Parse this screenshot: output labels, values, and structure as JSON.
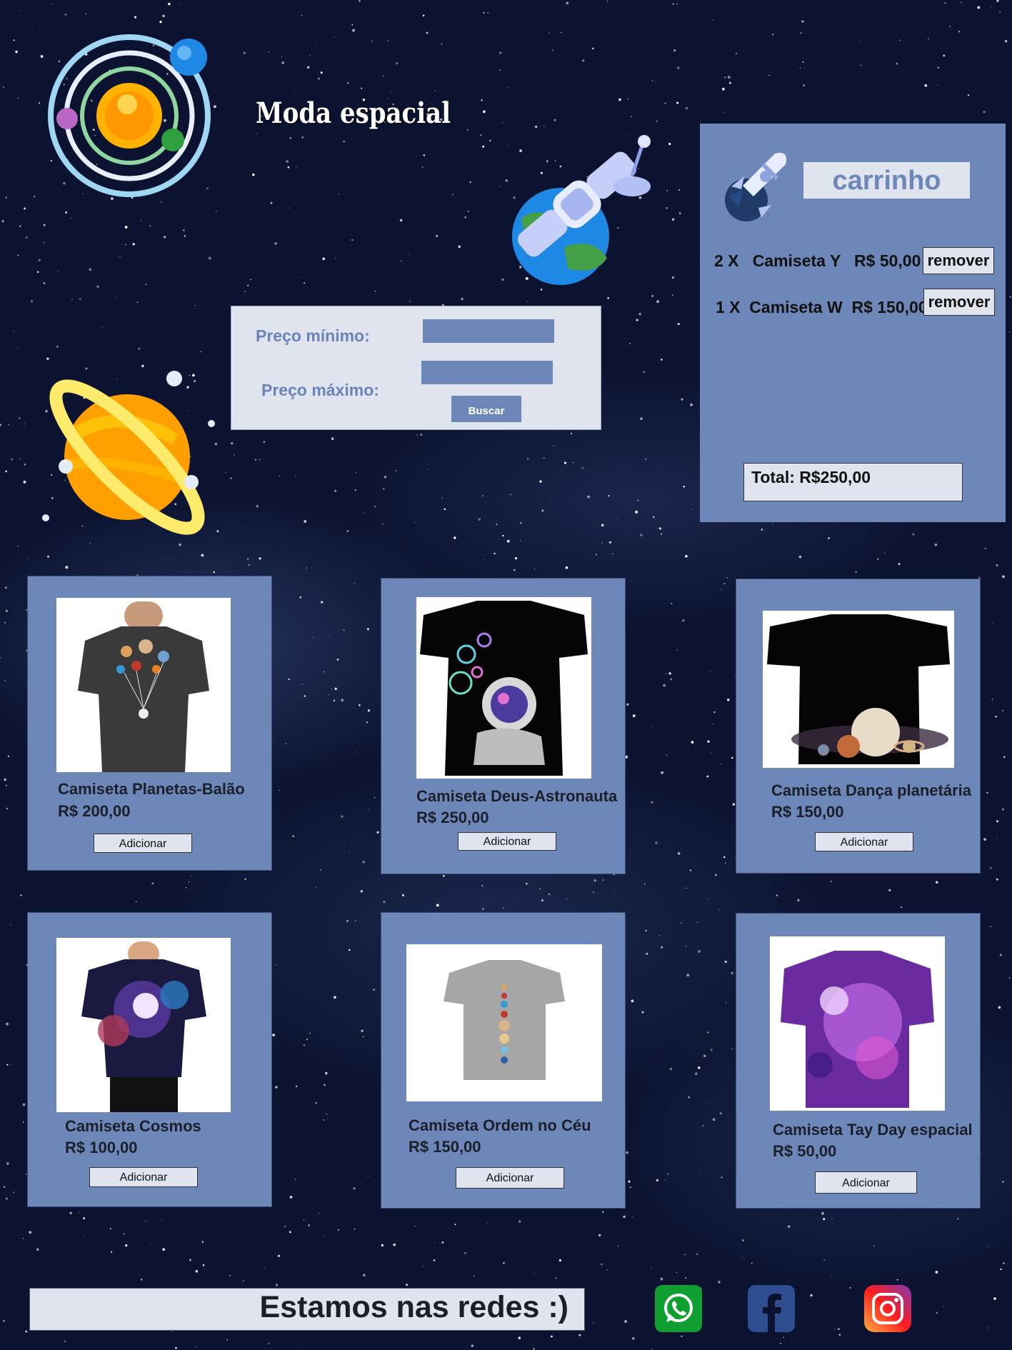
{
  "header": {
    "title": "Moda espacial"
  },
  "filter": {
    "min_label": "Preço mínimo:",
    "max_label": "Preço máximo:",
    "search_label": "Buscar"
  },
  "cart": {
    "title": "carrinho",
    "items": [
      {
        "line": "2 X   Camiseta Y   R$ 50,00",
        "remove_label": "remover"
      },
      {
        "line": "1 X  Camiseta W  R$ 150,00",
        "remove_label": "remover"
      }
    ],
    "total": "Total:  R$250,00"
  },
  "products": [
    {
      "name": "Camiseta Planetas-Balão",
      "price": "R$ 200,00",
      "add_label": "Adicionar"
    },
    {
      "name": "Camiseta Deus-Astronauta",
      "price": "R$ 250,00",
      "add_label": "Adicionar"
    },
    {
      "name": "Camiseta Dança planetária",
      "price": "R$ 150,00",
      "add_label": "Adicionar"
    },
    {
      "name": "Camiseta Cosmos",
      "price": "R$ 100,00",
      "add_label": "Adicionar"
    },
    {
      "name": "Camiseta Ordem no Céu",
      "price": "R$ 150,00",
      "add_label": "Adicionar"
    },
    {
      "name": "Camiseta Tay Day espacial",
      "price": "R$ 50,00",
      "add_label": "Adicionar"
    }
  ],
  "footer": {
    "text": "Estamos nas redes :)"
  },
  "social": [
    {
      "icon": "whatsapp-icon",
      "color": "#0e9f30"
    },
    {
      "icon": "facebook-icon",
      "color": "#2f4e8f"
    },
    {
      "icon": "instagram-icon",
      "color": "#e1306c"
    }
  ],
  "colors": {
    "panel": "#6d87b8",
    "light": "#dfe4ee",
    "background": "#0b1330"
  }
}
